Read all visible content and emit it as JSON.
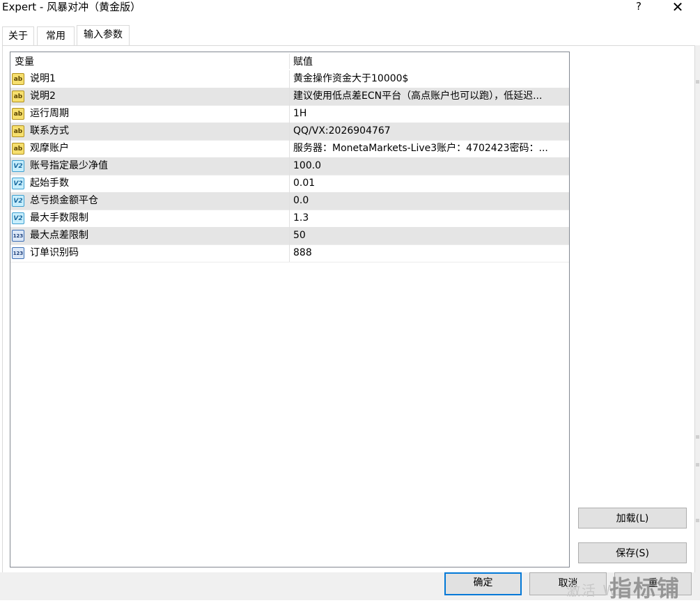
{
  "window": {
    "title": "Expert - 风暴对冲（黄金版）",
    "help_label": "?",
    "close_label": "✕"
  },
  "tabs": [
    {
      "label": "关于",
      "active": false
    },
    {
      "label": "常用",
      "active": false
    },
    {
      "label": "输入参数",
      "active": true
    }
  ],
  "grid": {
    "headers": {
      "variable": "变量",
      "value": "赋值"
    },
    "rows": [
      {
        "icon": "ab",
        "name": "说明1",
        "value": "黄金操作资金大于10000$"
      },
      {
        "icon": "ab",
        "name": "说明2",
        "value": "建议使用低点差ECN平台（高点账户也可以跑），低延迟..."
      },
      {
        "icon": "ab",
        "name": "运行周期",
        "value": "1H"
      },
      {
        "icon": "ab",
        "name": "联系方式",
        "value": "QQ/VX:2026904767"
      },
      {
        "icon": "ab",
        "name": "观摩账户",
        "value": "服务器：MonetaMarkets-Live3账户：4702423密码：..."
      },
      {
        "icon": "v2",
        "name": "账号指定最少净值",
        "value": "100.0"
      },
      {
        "icon": "v2",
        "name": "起始手数",
        "value": "0.01"
      },
      {
        "icon": "v2",
        "name": "总亏损金额平仓",
        "value": "0.0"
      },
      {
        "icon": "v2",
        "name": "最大手数限制",
        "value": "1.3"
      },
      {
        "icon": "123",
        "name": "最大点差限制",
        "value": "50"
      },
      {
        "icon": "123",
        "name": "订单识别码",
        "value": "888"
      }
    ],
    "icon_labels": {
      "ab": "ab",
      "v2": "V2",
      "123": "123"
    }
  },
  "buttons": {
    "load": "加载(L)",
    "save": "保存(S)",
    "ok": "确定",
    "cancel": "取消",
    "reset_partial": "重"
  },
  "watermark": {
    "small": "激活 W",
    "big": "指标铺"
  }
}
